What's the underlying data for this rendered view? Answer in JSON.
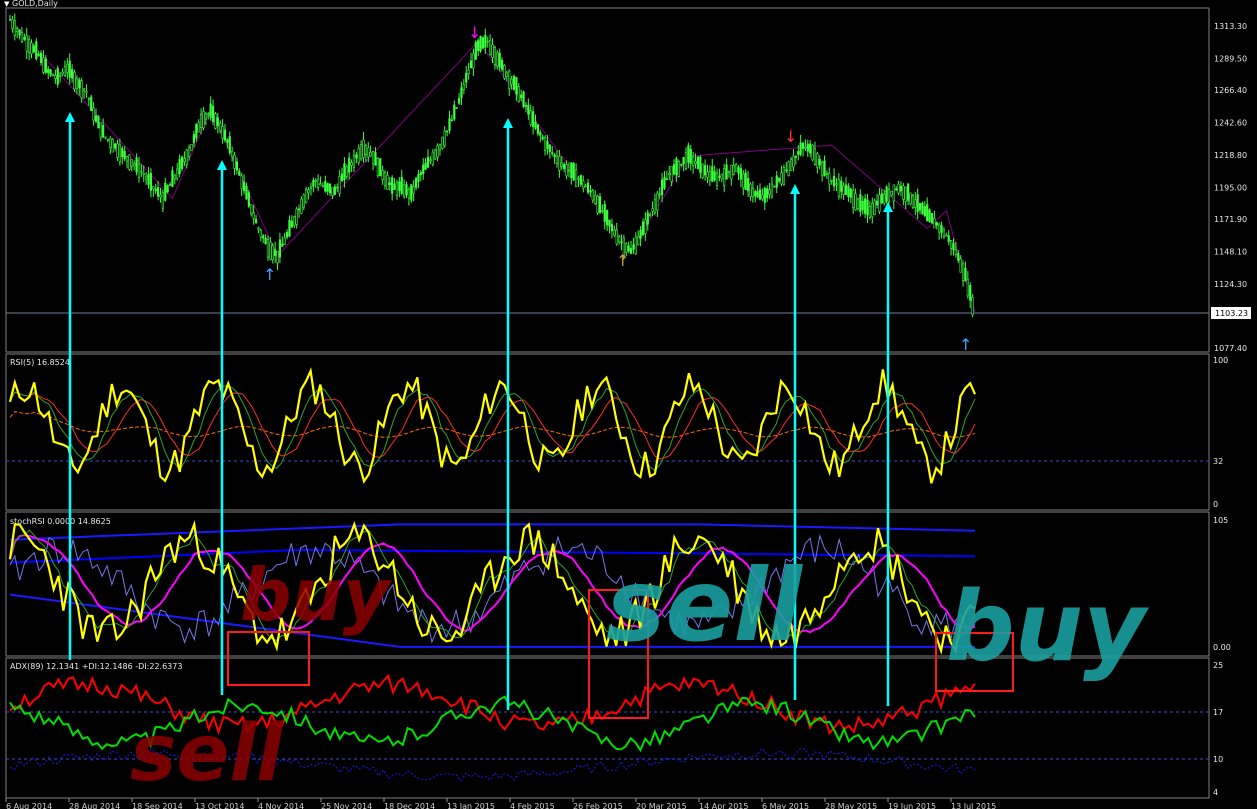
{
  "symbol_label": "GOLD,Daily",
  "current_price": "1103.23",
  "price_axis": [
    "1313.30",
    "1289.50",
    "1266.40",
    "1242.60",
    "1218.80",
    "1195.00",
    "1171.90",
    "1148.10",
    "1124.30",
    "1077.40"
  ],
  "rsi": {
    "label": "RSI(5) 16.8524",
    "ticks": [
      "100",
      "32",
      "0"
    ]
  },
  "stochrsi": {
    "label": "stochRSI 0.0000 14.8625",
    "ticks": [
      "105",
      "0.00"
    ]
  },
  "adx": {
    "label": "ADX(89) 12.1341 +DI:12.1486 -DI:22.6373",
    "ticks": [
      "25",
      "17",
      "10",
      "4"
    ]
  },
  "date_axis": [
    "6 Aug 2014",
    "28 Aug 2014",
    "18 Sep 2014",
    "13 Oct 2014",
    "4 Nov 2014",
    "25 Nov 2014",
    "18 Dec 2014",
    "13 Jan 2015",
    "4 Feb 2015",
    "26 Feb 2015",
    "20 Mar 2015",
    "14 Apr 2015",
    "6 May 2015",
    "28 May 2015",
    "19 Jun 2015",
    "13 Jul 2015"
  ],
  "annotations": {
    "buy_1": "buy",
    "sell_1": "sell",
    "sell_2": "sell",
    "buy_2": "buy"
  },
  "colors": {
    "candles": "#3dff3d",
    "rsi": "#ffff00",
    "stoch_main": "#ffff00",
    "stoch_signal": "#ff00ff",
    "bands": "#0000ff",
    "plus_di": "#00dd00",
    "minus_di": "#ff0000",
    "arrows": "#00ffff",
    "zigzag": "#800080",
    "buy_hand": "#8b0000",
    "sell_hand": "#1a9ea0"
  },
  "chart_data": {
    "type": "candlestick",
    "title": "GOLD,Daily",
    "close_path": [
      1318,
      1308,
      1300,
      1292,
      1280,
      1275,
      1283,
      1272,
      1265,
      1245,
      1232,
      1225,
      1218,
      1212,
      1205,
      1195,
      1187,
      1200,
      1212,
      1225,
      1245,
      1250,
      1240,
      1225,
      1205,
      1185,
      1165,
      1152,
      1145,
      1160,
      1175,
      1190,
      1200,
      1195,
      1192,
      1205,
      1215,
      1225,
      1218,
      1205,
      1195,
      1195,
      1190,
      1205,
      1215,
      1225,
      1240,
      1258,
      1280,
      1298,
      1302,
      1290,
      1278,
      1268,
      1255,
      1240,
      1228,
      1218,
      1210,
      1205,
      1198,
      1190,
      1178,
      1165,
      1155,
      1148,
      1160,
      1175,
      1190,
      1205,
      1210,
      1218,
      1212,
      1205,
      1202,
      1205,
      1210,
      1198,
      1190,
      1188,
      1196,
      1205,
      1215,
      1225,
      1222,
      1210,
      1200,
      1195,
      1190,
      1182,
      1178,
      1185,
      1190,
      1195,
      1190,
      1182,
      1175,
      1168,
      1160,
      1148,
      1130,
      1103
    ],
    "ylim": [
      1077.4,
      1313.3
    ],
    "current_price": 1103.23
  }
}
